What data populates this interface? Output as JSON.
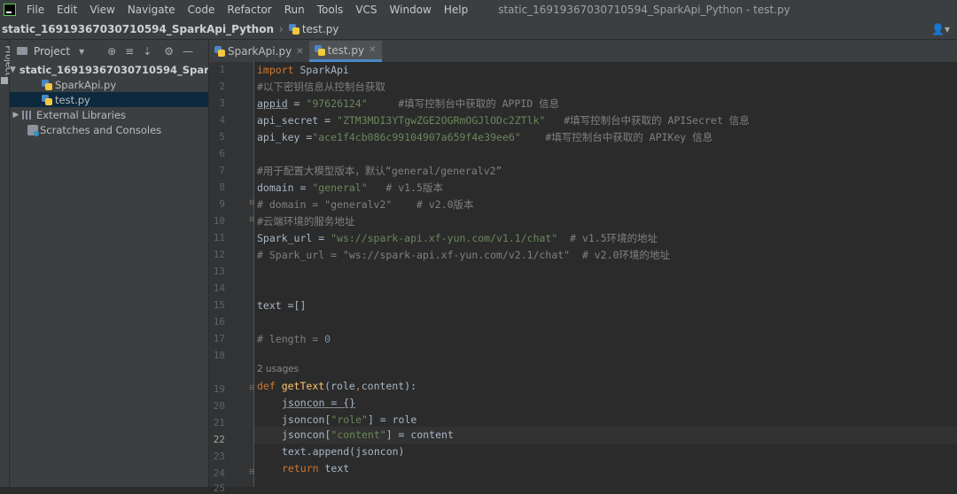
{
  "menubar": {
    "items": [
      "File",
      "Edit",
      "View",
      "Navigate",
      "Code",
      "Refactor",
      "Run",
      "Tools",
      "VCS",
      "Window",
      "Help"
    ],
    "window_title": "static_16919367030710594_SparkApi_Python - test.py"
  },
  "navbar": {
    "project": "static_16919367030710594_SparkApi_Python",
    "file": "test.py"
  },
  "toolstrip": {
    "label": "Project"
  },
  "project_panel": {
    "title": "Project",
    "tree": {
      "root": "static_16919367030710594_SparkApi",
      "files": [
        "SparkApi.py",
        "test.py"
      ],
      "external": "External Libraries",
      "scratches": "Scratches and Consoles"
    }
  },
  "tabs": [
    {
      "label": "SparkApi.py",
      "active": false
    },
    {
      "label": "test.py",
      "active": true
    }
  ],
  "editor": {
    "current_line": 22,
    "line_numbers": [
      "1",
      "2",
      "3",
      "4",
      "5",
      "6",
      "7",
      "8",
      "9",
      "10",
      "11",
      "12",
      "13",
      "14",
      "15",
      "16",
      "17",
      "18",
      "19",
      "20",
      "21",
      "22",
      "23",
      "24",
      "25"
    ],
    "usages_label": "2 usages",
    "code": {
      "l1_kw": "import",
      "l1_rest": " SparkApi",
      "l2": "#以下密钥信息从控制台获取",
      "l3_var": "appid",
      "l3_eq": " = ",
      "l3_str": "\"97626124\"",
      "l3_cm": "     #填写控制台中获取的 APPID 信息",
      "l4_var": "api_secret",
      "l4_eq": " = ",
      "l4_str": "\"ZTM3MDI3YTgwZGE2OGRmOGJlODc2ZTlk\"",
      "l4_cm": "   #填写控制台中获取的 APISecret 信息",
      "l5_var": "api_key",
      "l5_eq": " =",
      "l5_str": "\"ace1f4cb086c99104907a659f4e39ee6\"",
      "l5_cm": "    #填写控制台中获取的 APIKey 信息",
      "l7": "#用于配置大模型版本，默认“general/generalv2”",
      "l8_var": "domain",
      "l8_eq": " = ",
      "l8_str": "\"general\"",
      "l8_cm": "   # v1.5版本",
      "l9": "# domain = \"generalv2\"    # v2.0版本",
      "l10": "#云端环境的服务地址",
      "l11_var": "Spark_url",
      "l11_eq": " = ",
      "l11_str": "\"ws://spark-api.xf-yun.com/v1.1/chat\"",
      "l11_cm": "  # v1.5环境的地址",
      "l12": "# Spark_url = \"ws://spark-api.xf-yun.com/v2.1/chat\"  # v2.0环境的地址",
      "l15": "text =[]",
      "l17_cm": "# length = ",
      "l17_num": "0",
      "l19_kw": "def ",
      "l19_fn": "getText",
      "l19_a": "(role",
      "l19_b": ",",
      "l19_c": "content",
      "l19_d": "):",
      "l20": "jsoncon = {}",
      "l21_a": "jsoncon[",
      "l21_str": "\"role\"",
      "l21_b": "] = role",
      "l22_a": "jsoncon[",
      "l22_str": "\"content\"",
      "l22_b": "] = content",
      "l23": "text.append(jsoncon)",
      "l24_kw": "return",
      "l24_rest": " text"
    }
  }
}
